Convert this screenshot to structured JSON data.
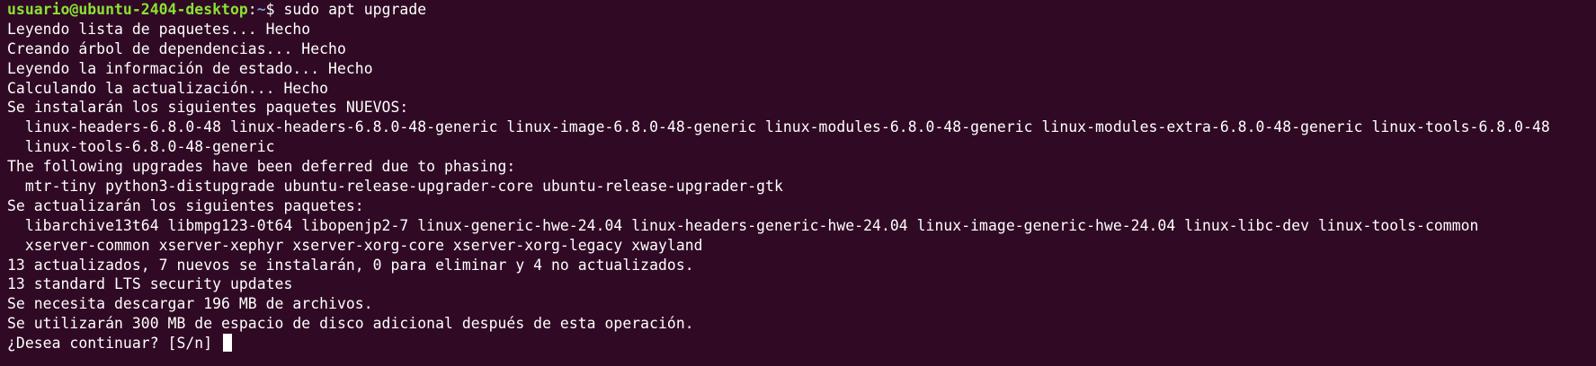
{
  "colors": {
    "background": "#300a24",
    "text": "#ffffff",
    "prompt_user_host": "#8ae234",
    "prompt_path": "#729fcf",
    "cursor": "#ffffff"
  },
  "prompt": {
    "user_host": "usuario@ubuntu-2404-desktop",
    "separator": ":",
    "path": "~",
    "symbol": "$ ",
    "command": "sudo apt upgrade"
  },
  "output_lines": [
    "Leyendo lista de paquetes... Hecho",
    "Creando árbol de dependencias... Hecho",
    "Leyendo la información de estado... Hecho",
    "Calculando la actualización... Hecho",
    "Se instalarán los siguientes paquetes NUEVOS:",
    "  linux-headers-6.8.0-48 linux-headers-6.8.0-48-generic linux-image-6.8.0-48-generic linux-modules-6.8.0-48-generic linux-modules-extra-6.8.0-48-generic linux-tools-6.8.0-48",
    "  linux-tools-6.8.0-48-generic",
    "The following upgrades have been deferred due to phasing:",
    "  mtr-tiny python3-distupgrade ubuntu-release-upgrader-core ubuntu-release-upgrader-gtk",
    "Se actualizarán los siguientes paquetes:",
    "  libarchive13t64 libmpg123-0t64 libopenjp2-7 linux-generic-hwe-24.04 linux-headers-generic-hwe-24.04 linux-image-generic-hwe-24.04 linux-libc-dev linux-tools-common",
    "  xserver-common xserver-xephyr xserver-xorg-core xserver-xorg-legacy xwayland",
    "13 actualizados, 7 nuevos se instalarán, 0 para eliminar y 4 no actualizados.",
    "13 standard LTS security updates",
    "Se necesita descargar 196 MB de archivos.",
    "Se utilizarán 300 MB de espacio de disco adicional después de esta operación."
  ],
  "final_prompt": "¿Desea continuar? [S/n] "
}
